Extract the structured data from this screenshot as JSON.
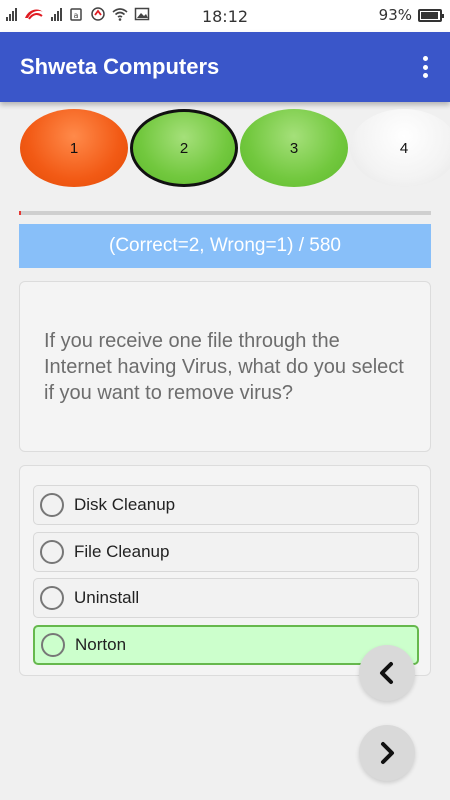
{
  "status_bar": {
    "time": "18:12",
    "battery_percent": "93%",
    "battery_level": 0.93,
    "icons": [
      "signal-icon",
      "airtel-icon",
      "signal-icon",
      "notification-icon",
      "data-saver-icon",
      "wifi-icon",
      "image-icon"
    ]
  },
  "app_bar": {
    "title": "Shweta Computers",
    "menu_icon": "more-vert-icon"
  },
  "question_bubbles": [
    {
      "number": "1",
      "state": "wrong",
      "color": "#f25a15"
    },
    {
      "number": "2",
      "state": "correct-selected",
      "color": "#72c83e"
    },
    {
      "number": "3",
      "state": "correct",
      "color": "#72c83e"
    },
    {
      "number": "4",
      "state": "unanswered",
      "color": "#f3f3f3"
    }
  ],
  "progress": {
    "fraction": 0.005,
    "color": "#e53935"
  },
  "score": {
    "text": "(Correct=2, Wrong=1) / 580"
  },
  "question": {
    "text": "If you receive one file through the Internet having Virus, what do you select if you want to remove virus?"
  },
  "options": [
    {
      "label": "Disk Cleanup",
      "state": "default"
    },
    {
      "label": "File Cleanup",
      "state": "default"
    },
    {
      "label": "Uninstall",
      "state": "default"
    },
    {
      "label": "Norton",
      "state": "correct"
    }
  ],
  "navigation": {
    "prev_icon": "chevron-left-icon",
    "next_icon": "chevron-right-icon"
  },
  "colors": {
    "app_bar": "#3a56c9",
    "score_bar": "#88bff9",
    "correct_option_bg": "#ccffcc",
    "correct_option_border": "#66b84d"
  }
}
